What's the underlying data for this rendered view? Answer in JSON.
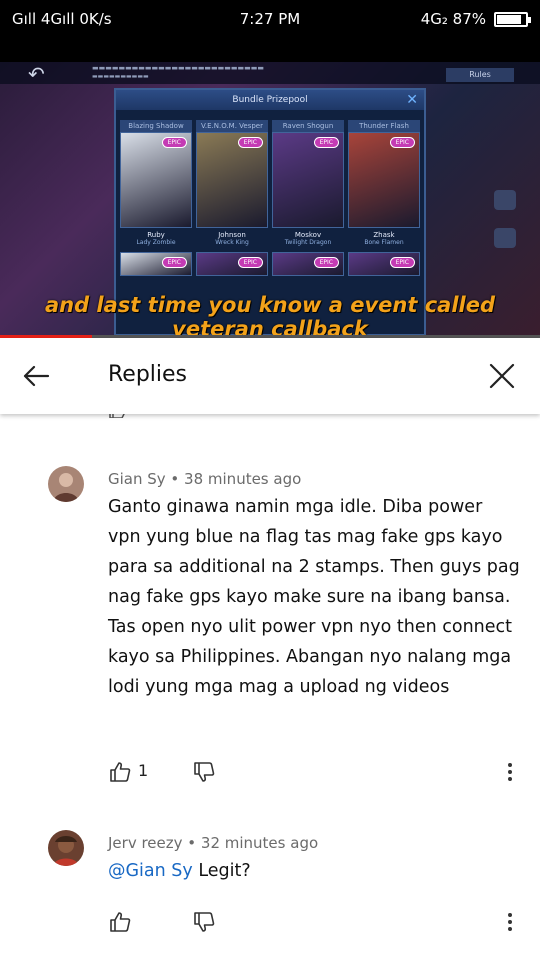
{
  "status_bar": {
    "left": "Gıll 4Gıll 0K/s",
    "time": "7:27 PM",
    "network": "4G₂ 87%",
    "battery_level": 0.87
  },
  "video": {
    "subtitle": "and last time you know a event called veteran callback",
    "progress_fraction": 0.17,
    "game": {
      "dialog_title": "Bundle Prizepool",
      "rules_label": "Rules",
      "tag": "EPIC",
      "cards": [
        {
          "top": "Blazing Shadow",
          "name": "Ruby",
          "sub": "Lady Zombie",
          "color": "#d9dfe8"
        },
        {
          "top": "V.E.N.O.M. Vesper Lowe",
          "name": "Johnson",
          "sub": "Wreck King",
          "color": "#8a7a55"
        },
        {
          "top": "Raven Shogun",
          "name": "Moskov",
          "sub": "Twilight Dragon",
          "color": "#5b3a86"
        },
        {
          "top": "Thunder Flash",
          "name": "Zhask",
          "sub": "Bone Flamen",
          "color": "#a8443a"
        }
      ]
    }
  },
  "header": {
    "title": "Replies"
  },
  "comments": [
    {
      "author": "Gian Sy",
      "time": "38 minutes ago",
      "text": "Ganto ginawa namin mga idle. Diba power vpn yung blue na flag tas mag fake gps kayo para sa additional na 2 stamps. Then guys pag nag fake gps kayo make sure na ibang bansa. Tas open nyo ulit power vpn nyo then connect kayo sa Philippines. Abangan nyo nalang mga lodi yung mga mag a upload ng videos",
      "likes": "1",
      "avatar_color": "#a88575"
    },
    {
      "author": "Jerv reezy",
      "time": "32 minutes ago",
      "mention": "@Gian Sy",
      "text": "Legit?",
      "likes": "",
      "avatar_color": "#6a4030"
    }
  ],
  "meta_separator": " • "
}
